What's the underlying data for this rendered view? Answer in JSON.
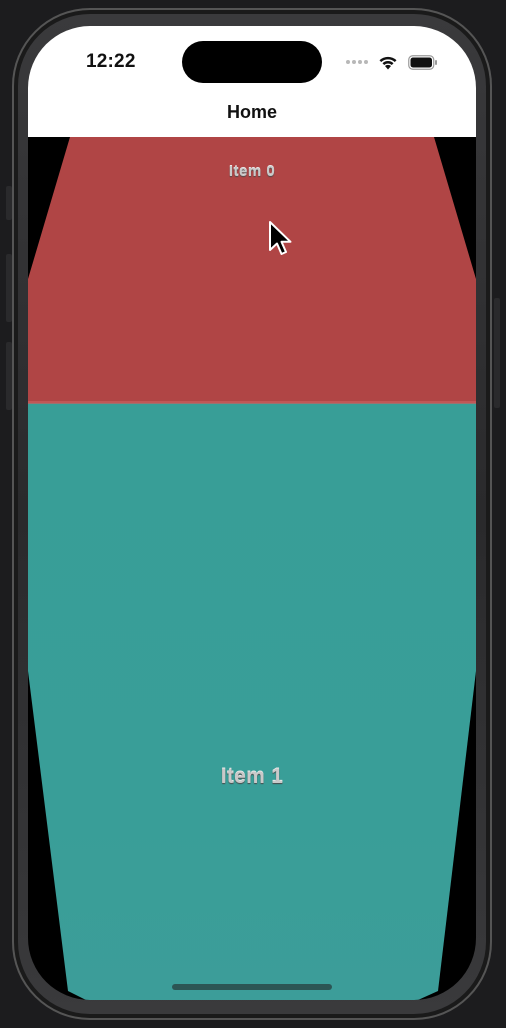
{
  "status_bar": {
    "time": "12:22",
    "icons": [
      "cellular-dots-icon",
      "wifi-icon",
      "battery-icon"
    ]
  },
  "navigation": {
    "title": "Home"
  },
  "items": [
    {
      "label": "Item 0",
      "color": "#b04545"
    },
    {
      "label": "Item 1",
      "color": "#389e97"
    }
  ],
  "colors": {
    "device_frame": "#2e2e30",
    "background": "#000000",
    "header": "#ffffff"
  }
}
